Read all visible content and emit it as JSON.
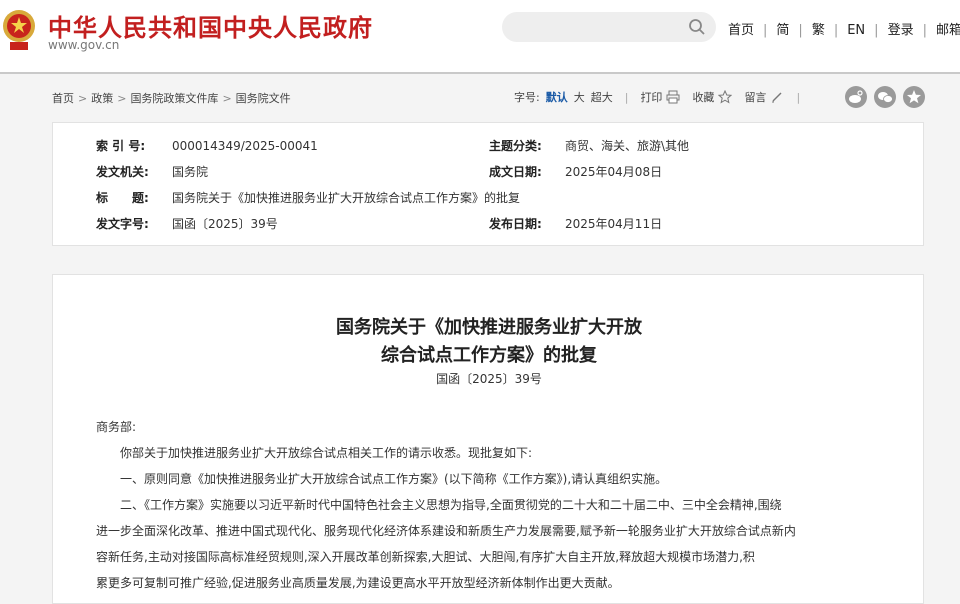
{
  "header": {
    "site_name": "中华人民共和国中央人民政府",
    "site_url": "www.gov.cn",
    "nav": [
      "首页",
      "简",
      "繁",
      "EN",
      "登录",
      "邮箱"
    ]
  },
  "breadcrumb": [
    "首页",
    "政策",
    "国务院政策文件库",
    "国务院文件"
  ],
  "toolbar": {
    "font_label": "字号:",
    "font_default": "默认",
    "font_large": "大",
    "font_xlarge": "超大",
    "print": "打印",
    "favorite": "收藏",
    "comment": "留言"
  },
  "meta": {
    "index_key": "索 引 号:",
    "index_val": "000014349/2025-00041",
    "topic_key": "主题分类:",
    "topic_val": "商贸、海关、旅游\\其他",
    "issuer_key": "发文机关:",
    "issuer_val": "国务院",
    "date_key": "成文日期:",
    "date_val": "2025年04月08日",
    "title_key": "标　　题:",
    "title_val": "国务院关于《加快推进服务业扩大开放综合试点工作方案》的批复",
    "docno_key": "发文字号:",
    "docno_val": "国函〔2025〕39号",
    "pub_key": "发布日期:",
    "pub_val": "2025年04月11日"
  },
  "article": {
    "title_line1": "国务院关于《加快推进服务业扩大开放",
    "title_line2": "综合试点工作方案》的批复",
    "doc_number": "国函〔2025〕39号",
    "salutation": "商务部:",
    "p1": "你部关于加快推进服务业扩大开放综合试点相关工作的请示收悉。现批复如下:",
    "p2": "一、原则同意《加快推进服务业扩大开放综合试点工作方案》(以下简称《工作方案》),请认真组织实施。",
    "p3_line1": "二、《工作方案》实施要以习近平新时代中国特色社会主义思想为指导,全面贯彻党的二十大和二十届二中、三中全会精神,围绕",
    "p3_line2": "进一步全面深化改革、推进中国式现代化、服务现代化经济体系建设和新质生产力发展需要,赋予新一轮服务业扩大开放综合试点新内",
    "p3_line3": "容新任务,主动对接国际高标准经贸规则,深入开展改革创新探索,大胆试、大胆闯,有序扩大自主开放,释放超大规模市场潜力,积",
    "p3_line4": "累更多可复制可推广经验,促进服务业高质量发展,为建设更高水平开放型经济新体制作出更大贡献。"
  },
  "colors": {
    "brand_red": "#c21f1f",
    "link_blue": "#1a5aa6"
  },
  "icons": [
    "national-emblem-icon",
    "search-icon",
    "print-icon",
    "star-icon",
    "pencil-icon",
    "weibo-icon",
    "wechat-icon",
    "favorite-icon"
  ]
}
